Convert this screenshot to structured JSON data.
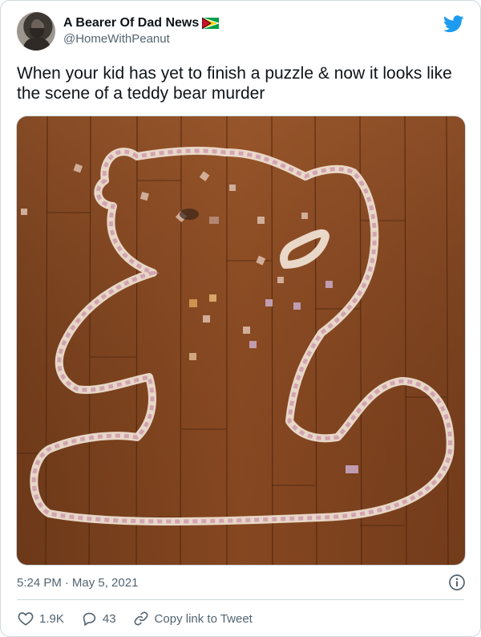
{
  "tweet": {
    "display_name": "A Bearer Of Dad News",
    "handle": "@HomeWithPeanut",
    "text": "When your kid has yet to finish a puzzle & now it looks like the scene of a teddy bear murder",
    "time": "5:24 PM",
    "separator": "·",
    "date": "May 5, 2021",
    "flag_icon": "guyana-flag-icon",
    "brand_color": "#1d9bf0"
  },
  "actions": {
    "likes": "1.9K",
    "replies": "43",
    "copy_link": "Copy link to Tweet"
  },
  "photo": {
    "subject": "puzzle-teddy-bear-outline-on-wood-floor"
  }
}
